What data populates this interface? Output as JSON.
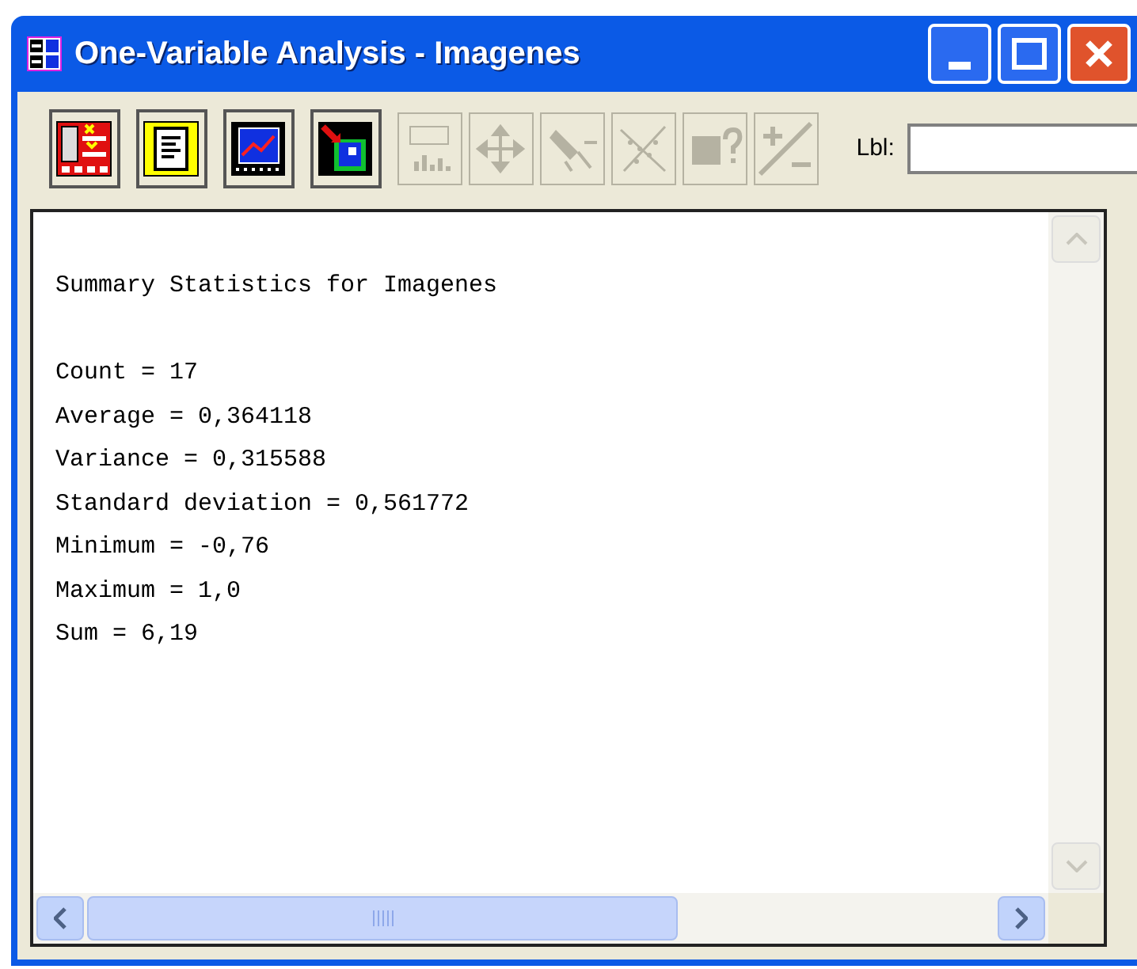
{
  "window": {
    "title": "One-Variable Analysis - Imagenes"
  },
  "toolbar": {
    "buttons": [
      {
        "kind": "input",
        "disabled": false
      },
      {
        "kind": "text",
        "disabled": false
      },
      {
        "kind": "graph",
        "disabled": false
      },
      {
        "kind": "save",
        "disabled": false
      },
      {
        "kind": "abc",
        "disabled": true
      },
      {
        "kind": "move",
        "disabled": true
      },
      {
        "kind": "brush",
        "disabled": true
      },
      {
        "kind": "scatter",
        "disabled": true
      },
      {
        "kind": "query",
        "disabled": true
      },
      {
        "kind": "plusminus",
        "disabled": true
      }
    ],
    "label_field": {
      "label": "Lbl:"
    }
  },
  "output": {
    "heading": "Summary Statistics for Imagenes",
    "lines": [
      "Count = 17",
      "Average = 0,364118",
      "Variance = 0,315588",
      "Standard deviation = 0,561772",
      "Minimum = -0,76",
      "Maximum = 1,0",
      "Sum = 6,19"
    ]
  }
}
